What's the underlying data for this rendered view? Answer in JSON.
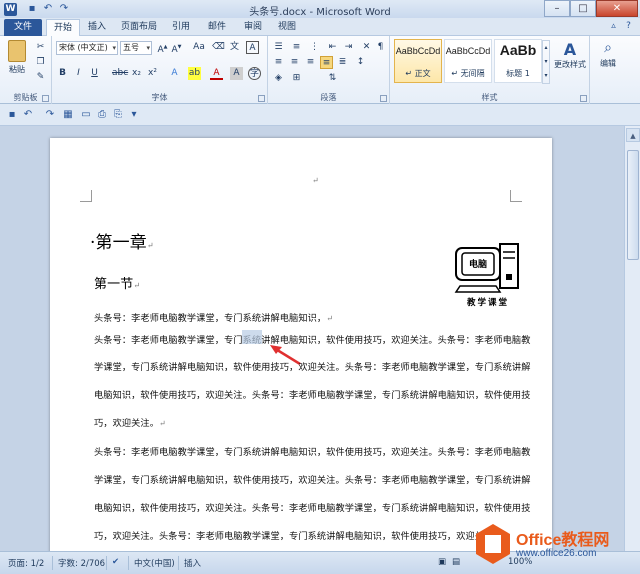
{
  "window": {
    "title": "头条号.docx - Microsoft Word",
    "app_icon": "W",
    "controls": [
      "–",
      "□",
      "✕"
    ]
  },
  "tabs": [
    {
      "label": "文件"
    },
    {
      "label": "开始"
    },
    {
      "label": "插入"
    },
    {
      "label": "页面布局"
    },
    {
      "label": "引用"
    },
    {
      "label": "邮件"
    },
    {
      "label": "审阅"
    },
    {
      "label": "视图"
    }
  ],
  "ribbon": {
    "clipboard": {
      "label": "剪贴板",
      "paste": "粘贴"
    },
    "font": {
      "label": "字体",
      "font_name": "宋体 (中文正)",
      "font_size": "五号",
      "change_case": "Aa"
    },
    "paragraph": {
      "label": "段落"
    },
    "styles": {
      "label": "样式",
      "items": [
        {
          "sample": "AaBbCcDd",
          "name": "↵ 正文"
        },
        {
          "sample": "AaBbCcDd",
          "name": "↵ 无间隔"
        },
        {
          "sample": "AaBb",
          "name": "标题 1"
        }
      ],
      "change_styles": "更改样式"
    },
    "editing": {
      "label": "编辑"
    }
  },
  "document": {
    "heading1": "第一章",
    "heading2": "第一节",
    "para_mark": "↵",
    "lines": [
      "头条号：李老师电脑教学课堂，专门系统讲解电脑知识，",
      "头条号：李老师电脑教学课堂，专门系统讲解电脑知识，软件使用技巧，欢迎关注。头条号：李老师电脑教",
      "学课堂，专门系统讲解电脑知识，软件使用技巧，欢迎关注。头条号：李老师电脑教学课堂，专门系统讲解",
      "电脑知识，软件使用技巧，欢迎关注。头条号：李老师电脑教学课堂，专门系统讲解电脑知识，软件使用技",
      "巧，欢迎关注。",
      "头条号：李老师电脑教学课堂，专门系统讲解电脑知识，软件使用技巧，欢迎关注。头条号：李老师电脑教",
      "学课堂，专门系统讲解电脑知识，软件使用技巧，欢迎关注。头条号：李老师电脑教学课堂，专门系统讲解",
      "电脑知识，软件使用技巧，欢迎关注。头条号：李老师电脑教学课堂，专门系统讲解电脑知识，软件使用技",
      "巧，欢迎关注。头条号：李老师电脑教学课堂，专门系统讲解电脑知识，软件使用技巧，欢迎关注。"
    ],
    "logo": {
      "screen_text": "电脑",
      "caption": "教学课堂"
    }
  },
  "status": {
    "page": "页面: 1/2",
    "words": "字数: 2/706",
    "language": "中文(中国)",
    "mode": "插入",
    "zoom": "100%"
  },
  "watermark": {
    "brand": "Office教程网",
    "url": "www.office26.com"
  },
  "colors": {
    "accent": "#2b579a",
    "watermark": "#e95b1c",
    "selection": "#b8cce4"
  }
}
